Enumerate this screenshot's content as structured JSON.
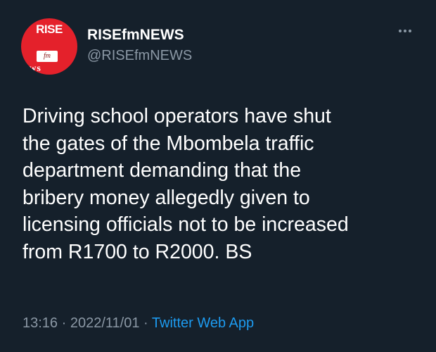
{
  "account": {
    "avatar_text_top": "RISE",
    "avatar_text_mid": "fm",
    "avatar_text_bottom": "ews",
    "display_name": "RISEfmNEWS",
    "handle": "@RISEfmNEWS"
  },
  "tweet": {
    "text": "Driving school operators have shut\nthe gates of the Mbombela traffic\ndepartment demanding that the\nbribery money allegedly given to\nlicensing officials not to be increased\nfrom R1700 to R2000. BS",
    "time": "13:16",
    "separator_1": " · ",
    "date": "2022/11/01",
    "separator_2": " · ",
    "source": "Twitter Web App"
  },
  "icons": {
    "more": "more-horizontal-icon"
  },
  "colors": {
    "background": "#15202b",
    "primary_text": "#ffffff",
    "secondary_text": "#8b98a5",
    "link": "#1d9bf0",
    "avatar": "#e4212b"
  }
}
